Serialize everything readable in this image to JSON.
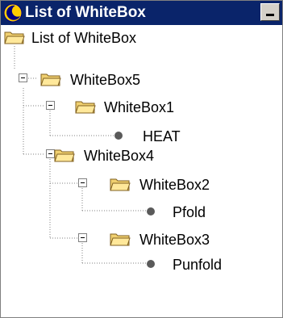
{
  "window": {
    "title": "List of WhiteBox"
  },
  "tree": {
    "root": "List of WhiteBox",
    "wb5": "WhiteBox5",
    "wb1": "WhiteBox1",
    "heat": "HEAT",
    "wb4": "WhiteBox4",
    "wb2": "WhiteBox2",
    "pfold": "Pfold",
    "wb3": "WhiteBox3",
    "punfold": "Punfold"
  }
}
